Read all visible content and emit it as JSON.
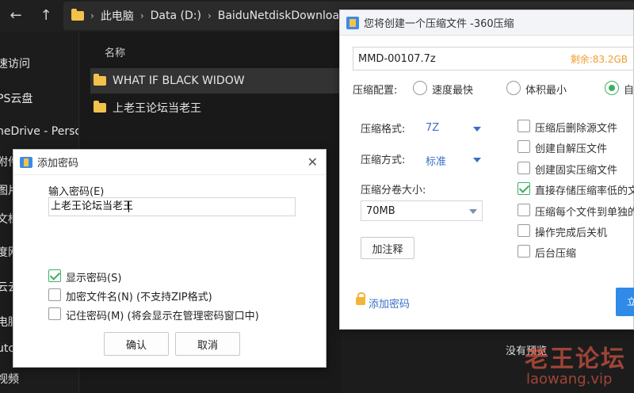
{
  "explorer": {
    "breadcrumb": [
      "此电脑",
      "Data (D:)",
      "BaiduNetdiskDownload"
    ],
    "column_name": "名称",
    "files": [
      "WHAT IF BLACK WIDOW",
      "上老王论坛当老王"
    ],
    "sidebar": [
      "速访问",
      "PS云盘",
      "neDrive - Persor",
      "附件",
      "图片",
      "文档",
      "度网",
      "云云",
      "电脑",
      "utc",
      "视频"
    ],
    "empty_text": "没有预览",
    "watermark": "老王论坛",
    "watermark_sub": "laowang.vip",
    "icons": {
      "back": "arrow-left-icon",
      "up": "arrow-up-icon"
    }
  },
  "compress_dialog": {
    "title": "您将创建一个压缩文件 -360压缩",
    "filename": "MMD-00107.7z",
    "free_space": "剩余:83.2GB",
    "config_label": "压缩配置:",
    "modes": [
      "速度最快",
      "体积最小",
      "自"
    ],
    "format_label": "压缩格式:",
    "format_value": "7Z",
    "method_label": "压缩方式:",
    "method_value": "标准",
    "volume_label": "压缩分卷大小:",
    "volume_value": "70MB",
    "comment_button": "加注释",
    "options": [
      {
        "label": "压缩后删除源文件",
        "checked": false
      },
      {
        "label": "创建自解压文件",
        "checked": false
      },
      {
        "label": "创建固实压缩文件",
        "checked": false
      },
      {
        "label": "直接存储压缩率低的文",
        "checked": true
      },
      {
        "label": "压缩每个文件到单独的",
        "checked": false
      },
      {
        "label": "操作完成后关机",
        "checked": false
      },
      {
        "label": "后台压缩",
        "checked": false
      }
    ],
    "add_password_link": "添加密码",
    "start_button": "立"
  },
  "password_dialog": {
    "title": "添加密码",
    "input_label": "输入密码(E)",
    "password_value": "上老王论坛当老王",
    "options": [
      {
        "label": "显示密码(S)",
        "checked": true
      },
      {
        "label": "加密文件名(N) (不支持ZIP格式)",
        "checked": false
      },
      {
        "label": "记住密码(M) (将会显示在管理密码窗口中)",
        "checked": false
      }
    ],
    "ok_button": "确认",
    "cancel_button": "取消"
  },
  "colors": {
    "accent_green": "#3fae64",
    "link_blue": "#3a6fc6",
    "free_orange": "#f29b2c",
    "primary_blue": "#2f8ae8"
  }
}
